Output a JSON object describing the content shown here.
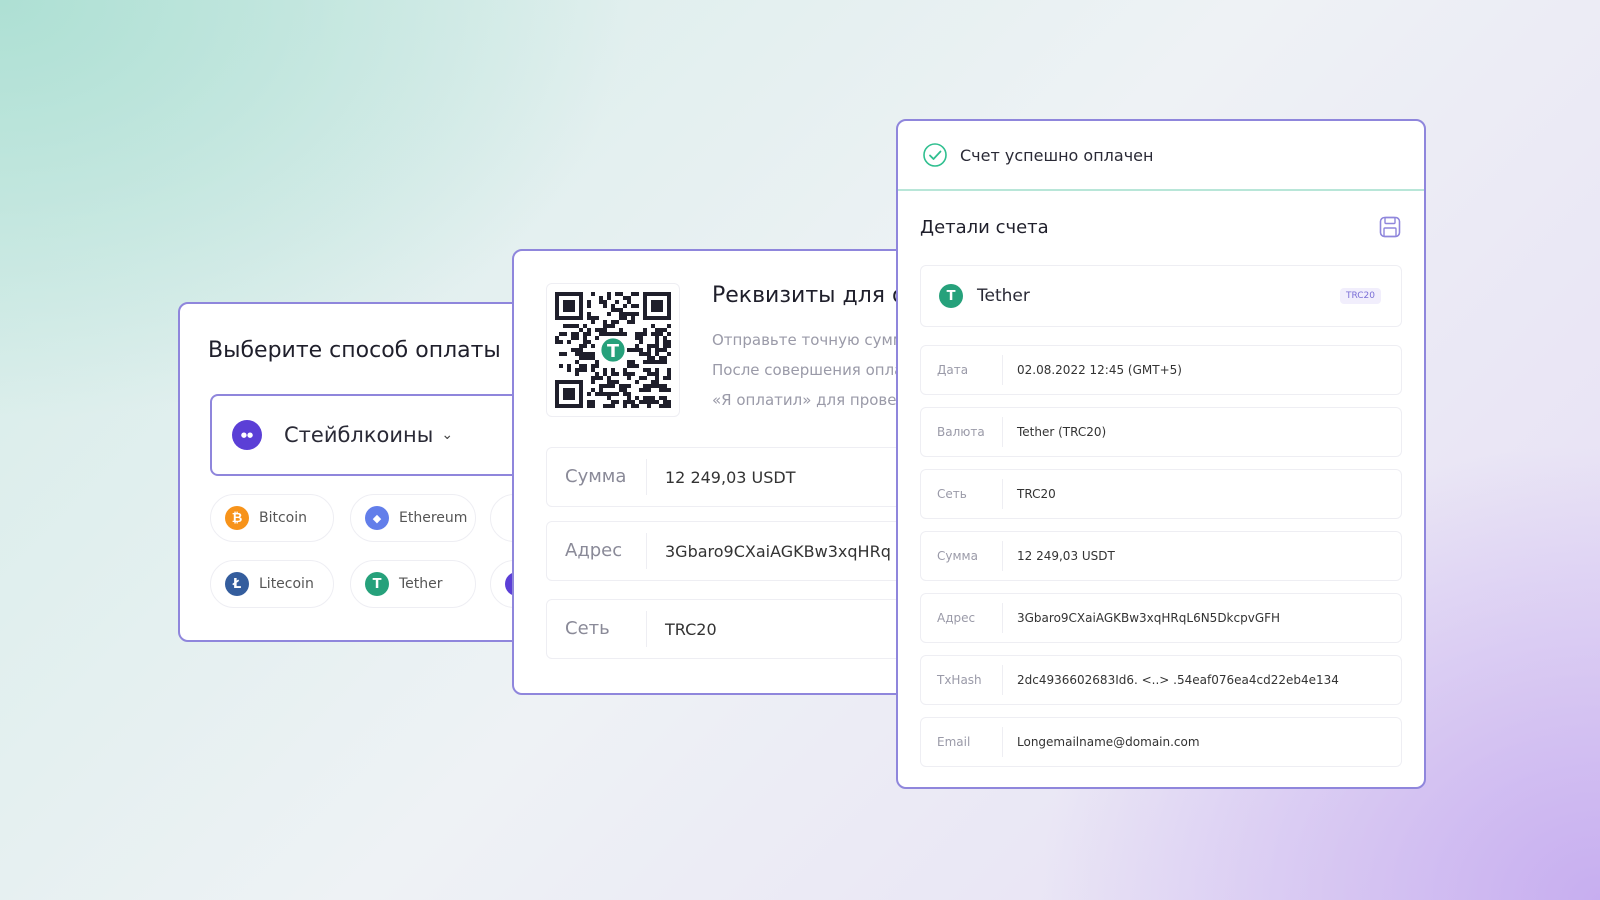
{
  "colors": {
    "accent": "#8f86dc",
    "success": "#2fbf8f",
    "tether": "#26a17b",
    "bitcoin": "#f7931a",
    "ethereum": "#627eea",
    "litecoin": "#345d9d",
    "stablecoin": "#5b3fd6"
  },
  "method_card": {
    "title": "Выберите способ оплаты",
    "select": {
      "icon": "stablecoin-logo-icon",
      "value": "Стейблкоины"
    },
    "coins": [
      {
        "label": "Bitcoin",
        "icon": "bitcoin-icon",
        "glyph": "₿"
      },
      {
        "label": "Ethereum",
        "icon": "ethereum-icon",
        "glyph": "◆"
      },
      {
        "label": "Litecoin",
        "icon": "litecoin-icon",
        "glyph": "Ł"
      },
      {
        "label": "Tether",
        "icon": "tether-icon",
        "glyph": "T"
      }
    ]
  },
  "requisites_card": {
    "title": "Реквизиты для оплаты",
    "desc_lines": [
      "Отправьте точную сумму",
      "После совершения оплаты",
      "«Я оплатил» для проверки"
    ],
    "rows": [
      {
        "label": "Сумма",
        "value": "12 249,03 USDT"
      },
      {
        "label": "Адрес",
        "value": "3Gbaro9CXaiAGKBw3xqHRq"
      },
      {
        "label": "Сеть",
        "value": "TRC20"
      }
    ]
  },
  "invoice_card": {
    "status": "Счет успешно оплачен",
    "title": "Детали счета",
    "coin": {
      "name": "Tether",
      "badge": "TRC20",
      "glyph": "T"
    },
    "rows": [
      {
        "label": "Дата",
        "value": "02.08.2022 12:45 (GMT+5)"
      },
      {
        "label": "Валюта",
        "value": "Tether (TRC20)"
      },
      {
        "label": "Сеть",
        "value": "TRC20"
      },
      {
        "label": "Сумма",
        "value": "12 249,03 USDT"
      },
      {
        "label": "Адрес",
        "value": "3Gbaro9CXaiAGKBw3xqHRqL6N5DkcpvGFH"
      },
      {
        "label": "TxHash",
        "value": "2dc4936602683Id6. <..> .54eaf076ea4cd22eb4e134"
      },
      {
        "label": "Email",
        "value": "Longemailname@domain.com"
      }
    ]
  }
}
